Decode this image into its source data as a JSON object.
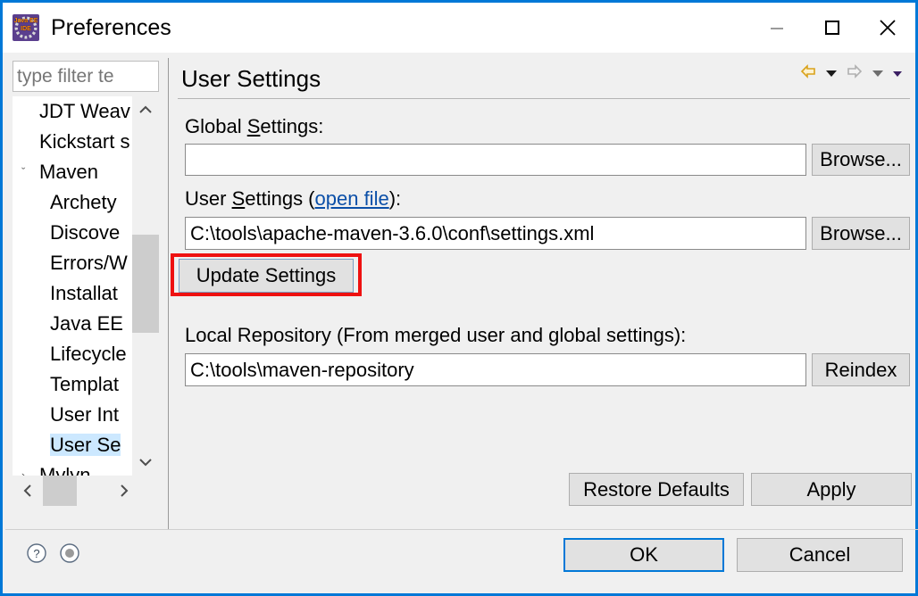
{
  "window": {
    "title": "Preferences",
    "app_icon": "eclipse-javaee-ide-icon",
    "icon_line1": "Java EE",
    "icon_line2": "IDE",
    "accent_color": "#0078d7",
    "controls": {
      "minimize": "minimize-button",
      "maximize": "maximize-button",
      "close": "close-button"
    }
  },
  "sidebar": {
    "filter": {
      "placeholder": "type filter te",
      "value": "type filter te"
    },
    "items": [
      {
        "label": "JDT Weav",
        "indent": 1,
        "twisty": "",
        "selected": false
      },
      {
        "label": "Kickstart s",
        "indent": 1,
        "twisty": "",
        "selected": false
      },
      {
        "label": "Maven",
        "indent": 1,
        "twisty": "ˇ",
        "selected": false
      },
      {
        "label": "Archety",
        "indent": 2,
        "twisty": "",
        "selected": false
      },
      {
        "label": "Discove",
        "indent": 2,
        "twisty": "",
        "selected": false
      },
      {
        "label": "Errors/W",
        "indent": 2,
        "twisty": "",
        "selected": false
      },
      {
        "label": "Installat",
        "indent": 2,
        "twisty": "",
        "selected": false
      },
      {
        "label": "Java EE",
        "indent": 2,
        "twisty": "",
        "selected": false
      },
      {
        "label": "Lifecycle",
        "indent": 2,
        "twisty": "",
        "selected": false
      },
      {
        "label": "Templat",
        "indent": 2,
        "twisty": "",
        "selected": false
      },
      {
        "label": "User Int",
        "indent": 2,
        "twisty": "",
        "selected": false
      },
      {
        "label": "User Se",
        "indent": 2,
        "twisty": "",
        "selected": true
      },
      {
        "label": "Mylyn",
        "indent": 1,
        "twisty": "›",
        "selected": false
      }
    ],
    "vscroll": {
      "up": "scroll-up-arrow",
      "down": "scroll-down-arrow"
    },
    "hscroll": {
      "left": "scroll-left-arrow",
      "right": "scroll-right-arrow"
    }
  },
  "main": {
    "title": "User Settings",
    "nav": {
      "back": "back-arrow-icon",
      "back_menu": "back-dropdown-icon",
      "forward": "forward-arrow-icon",
      "forward_menu": "forward-dropdown-icon",
      "view_menu": "view-menu-icon"
    },
    "global_settings": {
      "label_pre": "Global ",
      "label_mnemonic": "S",
      "label_post": "ettings:",
      "value": "",
      "placeholder": "",
      "browse_label": "Browse..."
    },
    "user_settings": {
      "label_pre": "User ",
      "label_mnemonic": "S",
      "label_mid": "ettings (",
      "link_label": "open file",
      "label_post": "):",
      "value": "C:\\tools\\apache-maven-3.6.0\\conf\\settings.xml",
      "browse_label": "Browse..."
    },
    "update_settings_label": "Update Settings",
    "local_repository": {
      "label": "Local Repository (From merged user and global settings):",
      "value": "C:\\tools\\maven-repository",
      "reindex_label": "Reindex"
    },
    "restore_defaults_label": "Restore Defaults",
    "apply_label": "Apply"
  },
  "footer": {
    "help_icon": "help-question-icon",
    "secondary_icon": "tray-circle-icon",
    "ok_label": "OK",
    "cancel_label": "Cancel"
  },
  "annotation": {
    "color": "#ee1111",
    "target": "update-settings-button"
  }
}
